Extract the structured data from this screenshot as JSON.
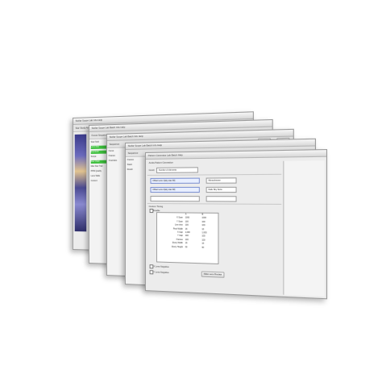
{
  "windows": [
    {
      "title": "Stellar  Scope  Lab  Info  Help",
      "toolbar_text": "Star Study   Andromeda",
      "toolbar_button": "Single Preview",
      "sidebar": [
        "Star Field",
        "Lens Axis",
        "Exposure",
        "Scope",
        "Star Chart",
        "Max Star Trail",
        "PPM Quality",
        "Lens Table",
        "Current"
      ]
    },
    {
      "title": "Stellar  Scope  Lab  Batch  Info  Help",
      "toolbar_text": "Focus   Sequence",
      "sidebar": [
        "Focus",
        "Frames",
        "Overrides"
      ]
    },
    {
      "title": "Stellar  Scope  Lab  Batch  Info  Help",
      "toolbar_text": "Sequence",
      "toolbar_button_a": "Load",
      "toolbar_button_b": "Save",
      "sidebar": [
        "Frames",
        "Stack",
        "Result"
      ]
    },
    {
      "title": "Stellar  Scope  Lab  Batch  Info  Help",
      "toolbar_text": "Sequence"
    },
    {
      "title": "Pattern Generator  Lab  Batch  Help",
      "subtitle": "Andra Pattern Generation",
      "field_label": "Count",
      "field_value": "Number of elements",
      "dropdowns": [
        "Offset Lens 1(sky star 48)",
        "Offset Lens 2(sky star 48)"
      ],
      "right_fields": [
        "Monochrome",
        "Dark Sky Sens"
      ],
      "section": "Custom Timing",
      "checkbox_label": "Enable",
      "table_header": [
        "",
        "A",
        "B"
      ],
      "table_rows": [
        [
          "X Scan",
          "1000",
          "1000"
        ],
        [
          "Y Scan",
          "100",
          "100"
        ],
        [
          "Line time",
          "100",
          "100"
        ],
        [
          "Pixel Width",
          "16",
          "16"
        ],
        [
          "X Gap",
          "1,000",
          "1,000"
        ],
        [
          "Y Gap",
          "100",
          "100"
        ],
        [
          "Frames",
          "100",
          "100"
        ],
        [
          "Every Width",
          "16",
          "16"
        ],
        [
          "Every Height",
          "60",
          "60"
        ]
      ],
      "bottom_labels": [
        "X Lens Negative",
        "Y Lens Negative"
      ],
      "bottom_button": "Make Lens Preview"
    }
  ]
}
